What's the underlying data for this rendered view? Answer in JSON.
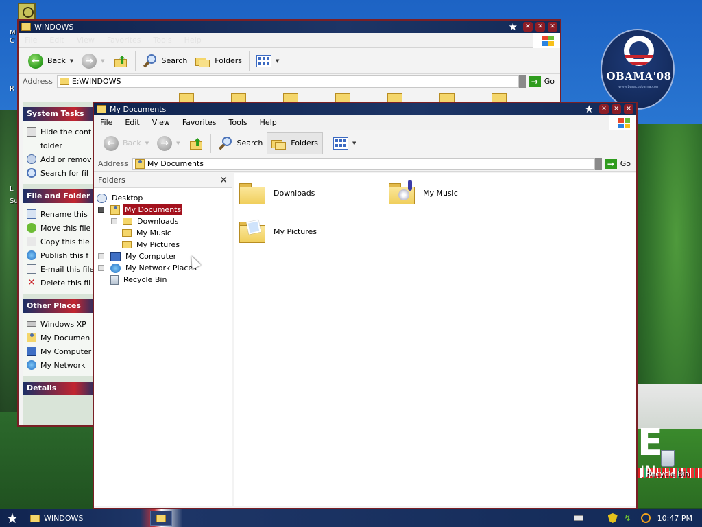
{
  "desktop": {
    "badge": {
      "name": "OBAMA'08",
      "url": "www.barackobama.com"
    },
    "recycle_bin_label": "Recycle Bin",
    "left_clipped_chars": [
      "M",
      "C",
      "R",
      "L",
      "Su"
    ],
    "big_letter": "E",
    "big_letter_sub": "IN"
  },
  "back_window": {
    "title": "WINDOWS",
    "menu": [
      "File",
      "Edit",
      "View",
      "Favorites",
      "Tools",
      "Help"
    ],
    "toolbar": {
      "back": "Back",
      "search": "Search",
      "folders": "Folders"
    },
    "address_label": "Address",
    "address_value": "E:\\WINDOWS",
    "go": "Go",
    "sections": [
      {
        "title": "System Tasks",
        "items": [
          "Hide the cont",
          "folder",
          "Add or remov",
          "Search for fil"
        ]
      },
      {
        "title": "File and Folder",
        "items": [
          "Rename this",
          "Move this file",
          "Copy this file",
          "Publish this f",
          "E-mail this file",
          "Delete this fil"
        ]
      },
      {
        "title": "Other Places",
        "items": [
          "Windows XP",
          "My Documen",
          "My Computer",
          "My Network"
        ]
      },
      {
        "title": "Details",
        "items": []
      }
    ]
  },
  "front_window": {
    "title": "My Documents",
    "menu": [
      "File",
      "Edit",
      "View",
      "Favorites",
      "Tools",
      "Help"
    ],
    "toolbar": {
      "back": "Back",
      "search": "Search",
      "folders": "Folders"
    },
    "address_label": "Address",
    "address_value": "My Documents",
    "go": "Go",
    "folders_pane_title": "Folders",
    "tree": [
      {
        "label": "Desktop"
      },
      {
        "label": "My Documents"
      },
      {
        "label": "Downloads"
      },
      {
        "label": "My Music"
      },
      {
        "label": "My Pictures"
      },
      {
        "label": "My Computer"
      },
      {
        "label": "My Network Places"
      },
      {
        "label": "Recycle Bin"
      }
    ],
    "items": [
      "Downloads",
      "My Music",
      "My Pictures"
    ]
  },
  "taskbar": {
    "buttons": [
      "WINDOWS",
      ""
    ],
    "clock": "10:47 PM"
  },
  "colors": {
    "title_bar": "#1d3566",
    "window_border": "#7a1f25",
    "selection": "#a3111d"
  }
}
